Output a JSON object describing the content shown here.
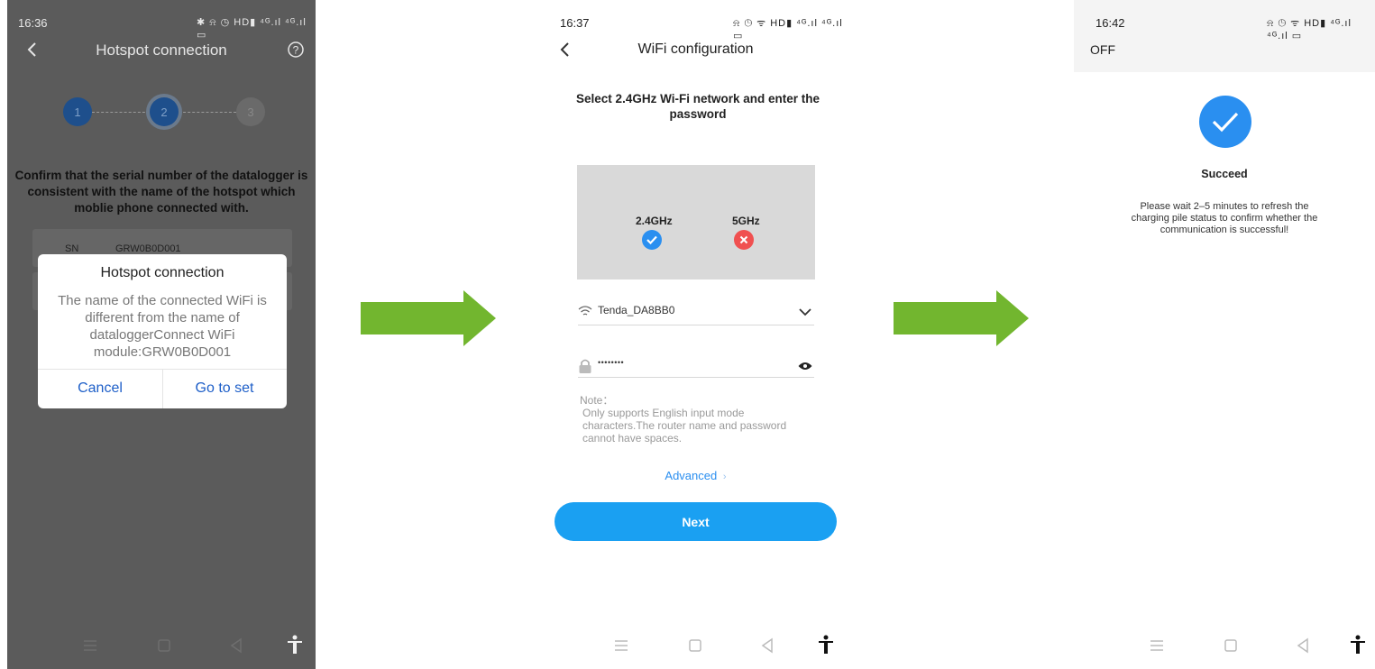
{
  "screen1": {
    "time": "16:36",
    "status_icons": "✱ ⍾ ◷ HD▮ ⁴ᴳ.ıl ⁴ᴳ.ıl ▭",
    "title": "Hotspot connection",
    "back_icon": "back-chevron-icon",
    "help_icon": "help-circle-icon",
    "steps": [
      "1",
      "2",
      "3"
    ],
    "confirm_text": "Confirm that the serial number of the datalogger is consistent with the name of the hotspot which moblie phone connected with.",
    "sn_label": "SN",
    "sn_value": "GRW0B0D001",
    "dialog": {
      "title": "Hotspot connection",
      "message": "The name of the connected WiFi is different from the name of dataloggerConnect WiFi module:GRW0B0D001",
      "cancel": "Cancel",
      "confirm": "Go to set"
    }
  },
  "screen2": {
    "time": "16:37",
    "status_icons": "⍾ ◷ ᯤ HD▮ ⁴ᴳ.ıl ⁴ᴳ.ıl ▭",
    "title": "WiFi configuration",
    "heading": "Select 2.4GHz Wi-Fi network and enter the password",
    "band_24": "2.4GHz",
    "band_5": "5GHz",
    "ssid": "Tenda_DA8BB0",
    "password_mask": "••••••••",
    "note_title": "Note：",
    "note_body": "Only supports English input mode characters.The router name and password cannot have spaces.",
    "advanced": "Advanced",
    "next": "Next"
  },
  "screen3": {
    "time": "16:42",
    "status_icons": "⍾ ◷ ᯤ HD▮ ⁴ᴳ.ıl ⁴ᴳ.ıl ▭",
    "off_label": "OFF",
    "success_title": "Succeed",
    "success_message": "Please wait 2–5 minutes to refresh the charging pile status to confirm whether the communication is successful!"
  },
  "colors": {
    "arrow_green": "#72b62f",
    "step_active": "#1e4f8c",
    "step_inactive": "#6a6a6a",
    "next_button": "#1aa0f2",
    "success_blue": "#2a8ff0",
    "error_red": "#f05050"
  }
}
